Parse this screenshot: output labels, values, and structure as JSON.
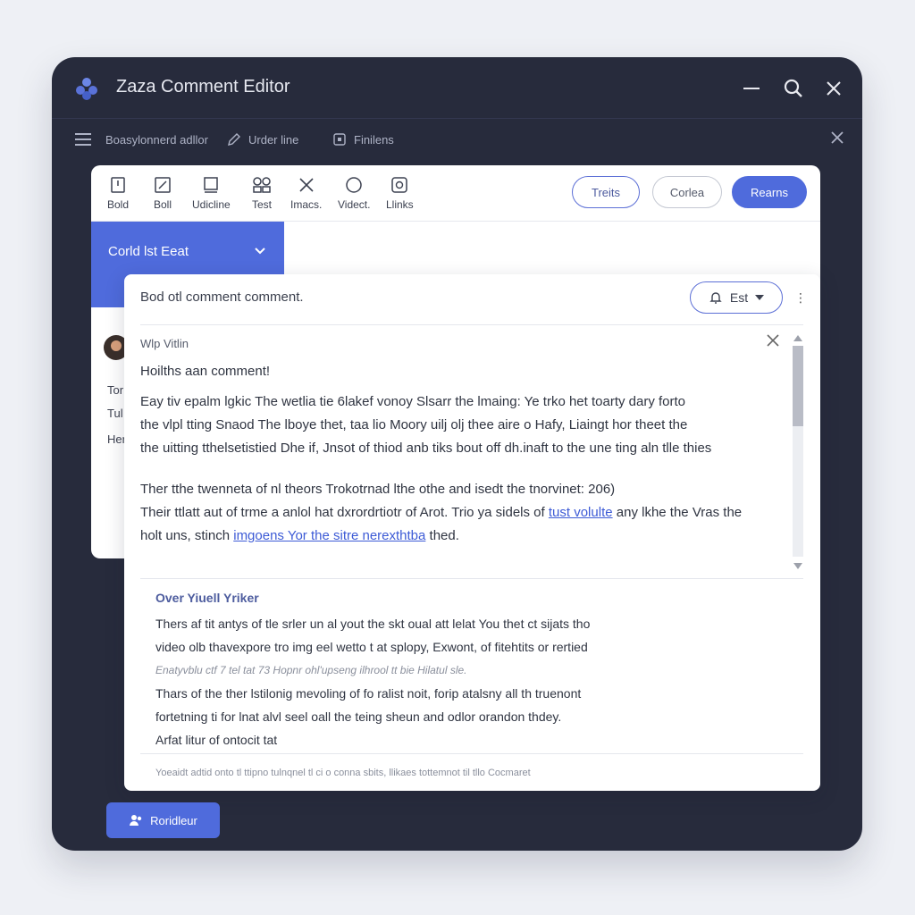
{
  "window": {
    "title": "Zaza Comment Editor"
  },
  "secondary_bar": {
    "item1": "Boasylonnerd adllor",
    "item2": "Urder line",
    "item3": "Finilens"
  },
  "toolbar": {
    "tools": [
      "Bold",
      "Boll",
      "Udicline",
      "Test",
      "Imacs.",
      "Videct.",
      "Llinks"
    ],
    "pill_1": "Treits",
    "pill_2": "Corlea",
    "pill_3": "Rearns"
  },
  "side": {
    "select_label": "Corld lst Eeat",
    "lines": [
      "Tor",
      "Tul",
      "Her"
    ]
  },
  "comment": {
    "title": "Bod otl comment comment.",
    "edit_label": "Est",
    "author": "Wlp Vitlin",
    "heading": "Hoilths aan comment!",
    "para1": [
      "Eay tiv epalm lgkic The wetlia tie 6lakef vonoy Slsarr the lmaing: Ye trko het toarty dary forto",
      "the vlpl tting Snaod The lboye thet, taa lio Moory uilj olj thee aire o Hafy, Liaingt hor theet the",
      "the uitting tthelsetistied Dhe if, Jnsot of thiod anb tiks bout off dh.inaft to the une ting aln tlle thies"
    ],
    "para2": [
      "Ther tthe twenneta of nl theors Trokotrnad lthe othe and isedt the tnorvinet: 206)",
      "Their ttlatt aut of trme a anlol hat dxrordrtiotr of Arot. Trio ya sidels of"
    ],
    "para2_link1": "tust volulte",
    "para2_tail1": " any lkhe the Vras the",
    "para2_line3_start": "holt uns, stinch ",
    "para2_link2": "imgoens Yor the sitre nerexthtba",
    "para2_line3_end": " thed."
  },
  "reply": {
    "heading": "Over Yiuell Yriker",
    "lines": [
      "Thers af tit antys of tle srler un al yout the skt oual att lelat You thet ct sijats tho",
      "video olb thavexpore tro img eel wetto t at splopy,  Exwont, of fitehtits or rertied"
    ],
    "meta": "Enatyvblu ctf 7 tel tat 73 Hopnr ohl'upseng ilhrool tt bie Hilatul sle.",
    "lines2": [
      "Thars of the ther lstilonig mevoling of fo ralist noit, forip atalsny all th truenont",
      "fortetning ti for lnat  alvl seel oall the teing sheun and odlor orandon thdey.",
      "Arfat litur of ontocit tat"
    ],
    "footnote": "Yoeaidt adtid onto tl ttipno tulnqnel tl ci o conna sbits, llikaes tottemnot til tllo Cocmaret"
  },
  "footer": {
    "button_label": "Roridleur"
  },
  "colors": {
    "accent": "#4f6bdc",
    "window_bg": "#272b3c",
    "page_bg": "#eef0f5"
  }
}
